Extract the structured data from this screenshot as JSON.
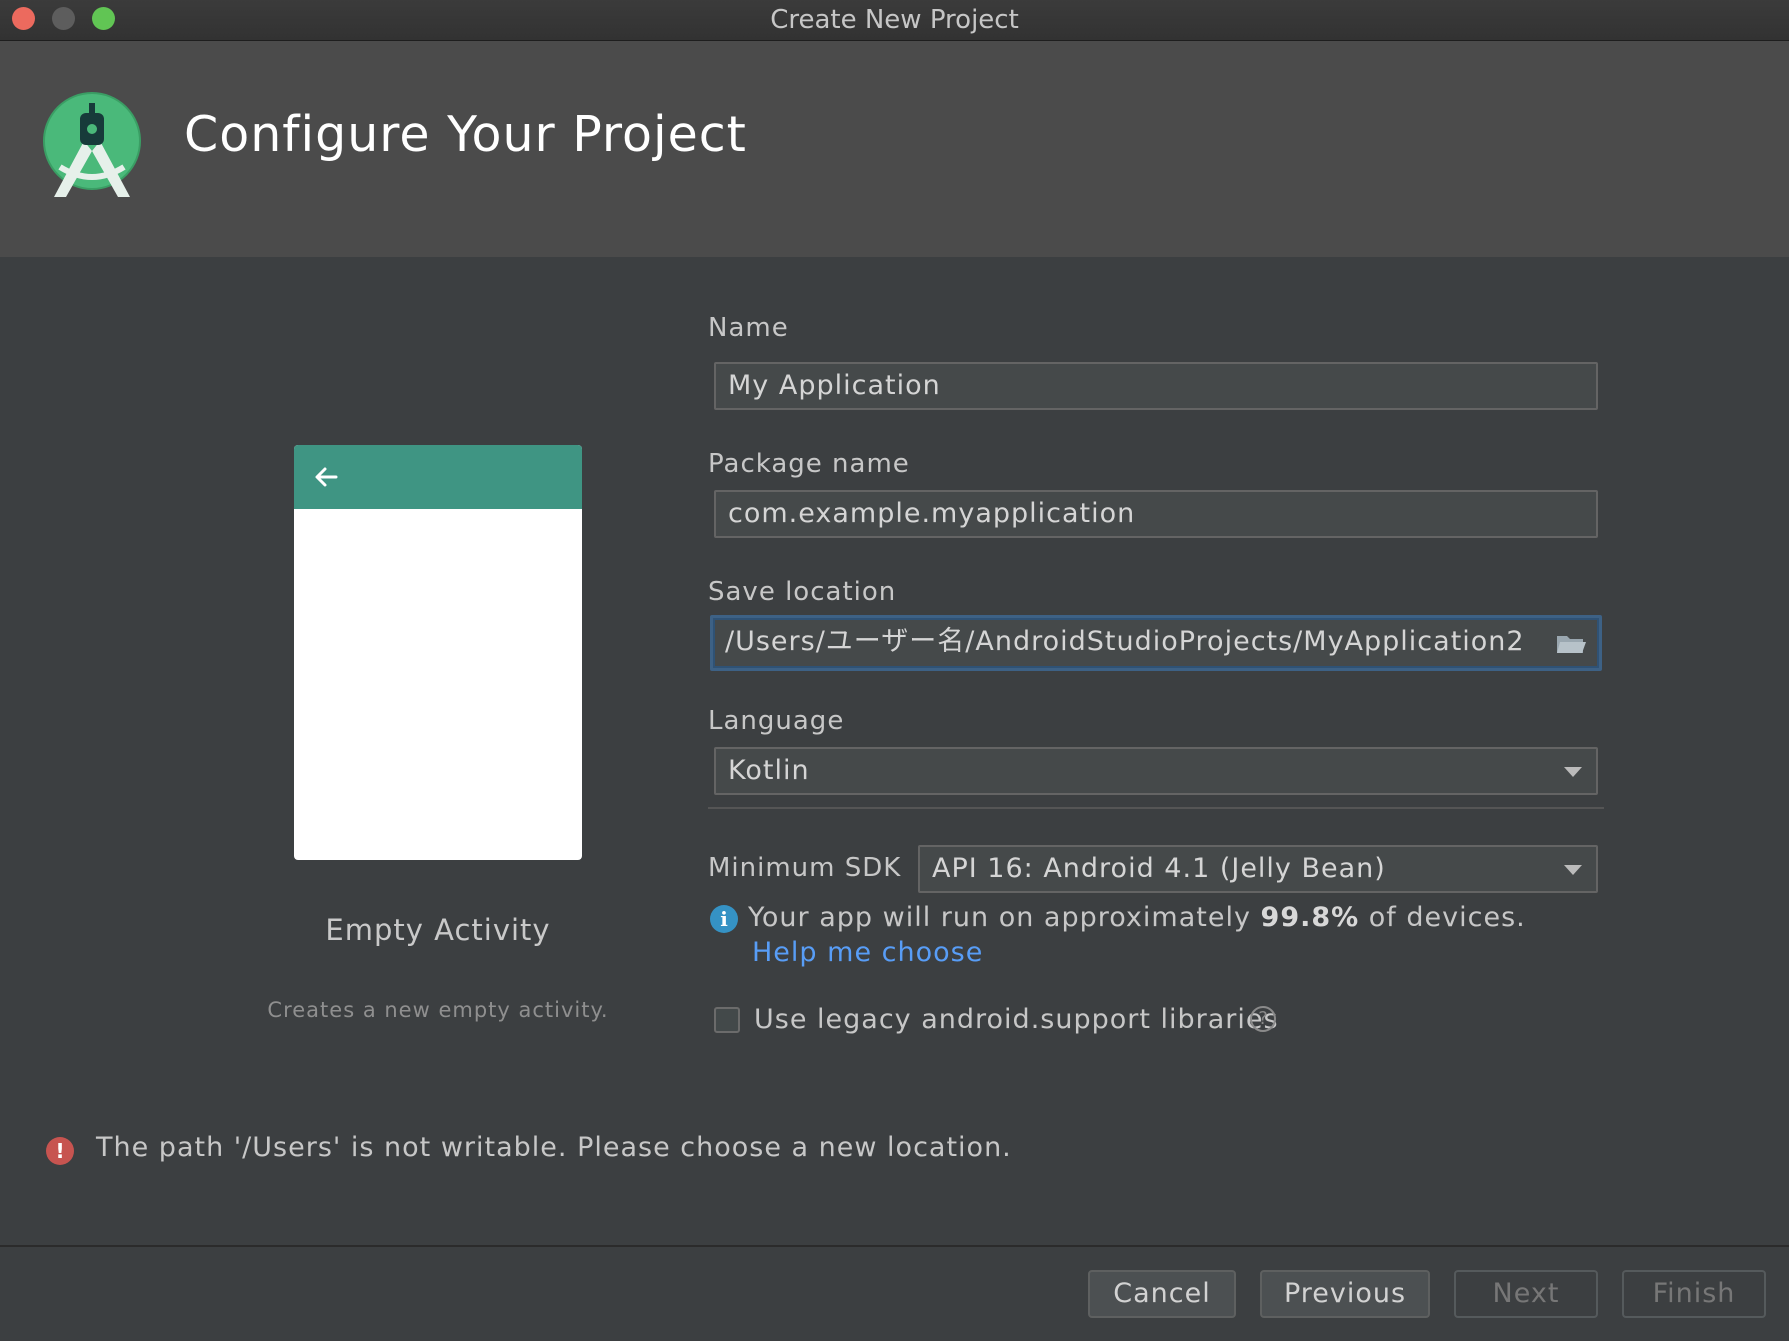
{
  "window": {
    "title": "Create New Project"
  },
  "header": {
    "title": "Configure Your Project",
    "logo_icon": "android-studio-logo-icon"
  },
  "template": {
    "name": "Empty Activity",
    "description": "Creates a new empty activity.",
    "appbar_color": "#3f9583"
  },
  "form": {
    "name": {
      "label": "Name",
      "value": "My Application"
    },
    "package": {
      "label": "Package name",
      "value": "com.example.myapplication"
    },
    "location": {
      "label": "Save location",
      "value": "/Users/ユーザー名/AndroidStudioProjects/MyApplication2",
      "icon": "folder-icon"
    },
    "language": {
      "label": "Language",
      "value": "Kotlin"
    },
    "min_sdk": {
      "label": "Minimum SDK",
      "value": "API 16: Android 4.1 (Jelly Bean)"
    },
    "info": {
      "prefix": "Your app will run on approximately ",
      "percent": "99.8%",
      "suffix": " of devices.",
      "help_link": "Help me choose"
    },
    "legacy": {
      "label": "Use legacy android.support libraries",
      "checked": false
    }
  },
  "error": {
    "message": "The path '/Users' is not writable. Please choose a new location."
  },
  "footer": {
    "cancel": "Cancel",
    "previous": "Previous",
    "next": "Next",
    "finish": "Finish"
  },
  "colors": {
    "accent_link": "#589df6",
    "error": "#c75450",
    "info": "#3592c4",
    "focus_border": "#3d6185"
  }
}
